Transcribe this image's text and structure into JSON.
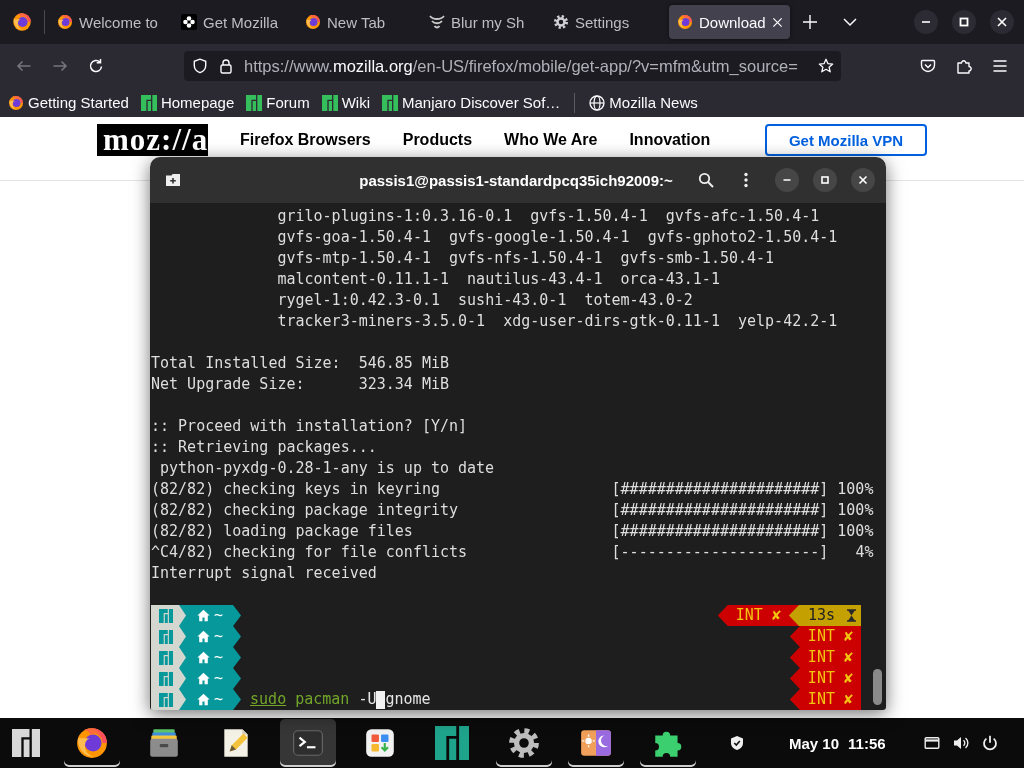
{
  "browser": {
    "tabs": [
      {
        "title": "Welcome to",
        "kind": "firefox",
        "selected": false
      },
      {
        "title": "Get Mozilla",
        "kind": "mozilla",
        "selected": false
      },
      {
        "title": "New Tab",
        "kind": "firefox",
        "selected": false
      },
      {
        "title": "Blur my Sh",
        "kind": "extension",
        "selected": false
      },
      {
        "title": "Settings",
        "kind": "settings",
        "selected": false
      },
      {
        "title": "Download",
        "kind": "firefox",
        "selected": true
      }
    ],
    "nav_buttons": [
      {
        "kind": "back",
        "disabled": true
      },
      {
        "kind": "forward",
        "disabled": true
      },
      {
        "kind": "reload",
        "disabled": false
      }
    ],
    "url": {
      "scheme": "https://www.",
      "domain": "mozilla.org",
      "path": "/en-US/firefox/mobile/get-app/?v=mfm&utm_source="
    },
    "bookmarks": [
      {
        "label": "Getting Started",
        "kind": "firefox"
      },
      {
        "label": "Homepage",
        "kind": "manjaro"
      },
      {
        "label": "Forum",
        "kind": "manjaro"
      },
      {
        "label": "Wiki",
        "kind": "manjaro"
      },
      {
        "label": "Manjaro Discover Sof…",
        "kind": "manjaro"
      },
      {
        "kind": "separator"
      },
      {
        "label": "Mozilla News",
        "kind": "globe"
      }
    ]
  },
  "page": {
    "logo": "moz://a",
    "nav": [
      "Firefox Browsers",
      "Products",
      "Who We Are",
      "Innovation"
    ],
    "cta": "Get Mozilla VPN"
  },
  "terminal": {
    "title": "passis1@passis1-standardpcq35ich92009:~",
    "lines": [
      {
        "kind": "package",
        "text": "grilo-plugins-1:0.3.16-0.1  gvfs-1.50.4-1  gvfs-afc-1.50.4-1"
      },
      {
        "kind": "package",
        "text": "gvfs-goa-1.50.4-1  gvfs-google-1.50.4-1  gvfs-gphoto2-1.50.4-1"
      },
      {
        "kind": "package",
        "text": "gvfs-mtp-1.50.4-1  gvfs-nfs-1.50.4-1  gvfs-smb-1.50.4-1"
      },
      {
        "kind": "package",
        "text": "malcontent-0.11.1-1  nautilus-43.4-1  orca-43.1-1"
      },
      {
        "kind": "package",
        "text": "rygel-1:0.42.3-0.1  sushi-43.0-1  totem-43.0-2"
      },
      {
        "kind": "package",
        "text": "tracker3-miners-3.5.0-1  xdg-user-dirs-gtk-0.11-1  yelp-42.2-1"
      },
      {
        "kind": "blank"
      },
      {
        "kind": "text",
        "text": "Total Installed Size:  546.85 MiB"
      },
      {
        "kind": "text",
        "text": "Net Upgrade Size:      323.34 MiB"
      },
      {
        "kind": "blank"
      },
      {
        "kind": "text",
        "text": ":: Proceed with installation? [Y/n]"
      },
      {
        "kind": "text",
        "text": ":: Retrieving packages..."
      },
      {
        "kind": "note",
        "text": "python-pyxdg-0.28-1-any is up to date"
      },
      {
        "kind": "progress",
        "label": "(82/82) checking keys in keyring",
        "bar": "[######################]",
        "percent": "100%"
      },
      {
        "kind": "progress",
        "label": "(82/82) checking package integrity",
        "bar": "[######################]",
        "percent": "100%"
      },
      {
        "kind": "progress",
        "label": "(82/82) loading package files",
        "bar": "[######################]",
        "percent": "100%"
      },
      {
        "kind": "progress",
        "label": "^C4/82) checking for file conflicts",
        "bar": "[----------------------]",
        "percent": "4%"
      },
      {
        "kind": "text",
        "text": "Interrupt signal received"
      },
      {
        "kind": "blank"
      }
    ],
    "prompts": [
      {
        "dir": "~",
        "status": "INT",
        "status_mark": "✘",
        "duration": "13s"
      },
      {
        "dir": "~",
        "status": "INT",
        "status_mark": "✘"
      },
      {
        "dir": "~",
        "status": "INT",
        "status_mark": "✘"
      },
      {
        "dir": "~",
        "status": "INT",
        "status_mark": "✘"
      },
      {
        "dir": "~",
        "status": "INT",
        "status_mark": "✘",
        "command": [
          {
            "text": "sudo",
            "kind": "precommand",
            "cursor_before": false
          },
          {
            "text": "pacman",
            "kind": "command",
            "cursor_before": false
          },
          {
            "text": "-U",
            "kind": "argument",
            "cursor_before": false
          },
          {
            "text": "gnome",
            "kind": "argument",
            "cursor_before": true
          }
        ]
      }
    ]
  },
  "taskbar": {
    "apps": [
      {
        "kind": "start",
        "running": false,
        "selected": false
      },
      {
        "kind": "firefox",
        "running": true,
        "selected": false
      },
      {
        "kind": "files",
        "running": false,
        "selected": false
      },
      {
        "kind": "editor",
        "running": false,
        "selected": false
      },
      {
        "kind": "terminal",
        "running": true,
        "selected": true
      },
      {
        "kind": "store",
        "running": false,
        "selected": false
      },
      {
        "kind": "hello",
        "running": false,
        "selected": false
      },
      {
        "kind": "settings",
        "running": true,
        "selected": false
      },
      {
        "kind": "theme",
        "running": true,
        "selected": false
      },
      {
        "kind": "extensions",
        "running": true,
        "selected": false
      }
    ],
    "clock": {
      "date": "May 10",
      "time": "11:56"
    }
  }
}
